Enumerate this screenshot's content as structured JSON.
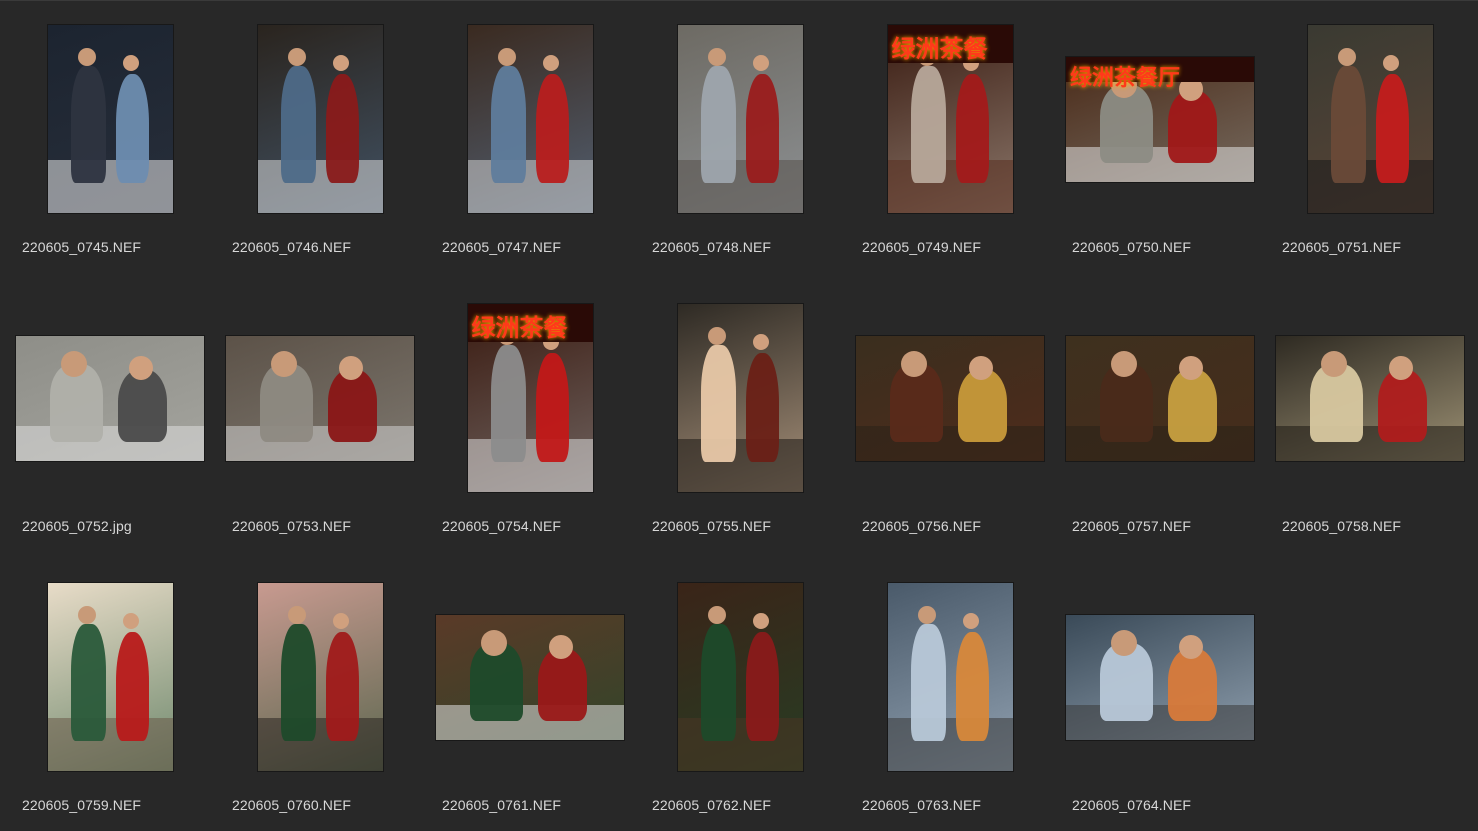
{
  "files": [
    {
      "name": "220605_0745.NEF",
      "orientation": "portrait",
      "bg": "#1c2430",
      "accent": "#6e8db0",
      "accent2": "#2e3440",
      "sign": "",
      "floor": "#e8e8e8"
    },
    {
      "name": "220605_0746.NEF",
      "orientation": "portrait",
      "bg": "#2a241e",
      "accent": "#8a1a1a",
      "accent2": "#4e6a88",
      "sign": "",
      "floor": "#d9d9d9"
    },
    {
      "name": "220605_0747.NEF",
      "orientation": "portrait",
      "bg": "#3a2a20",
      "accent": "#b81e1e",
      "accent2": "#5f7c9c",
      "sign": "",
      "floor": "#cfcfcf"
    },
    {
      "name": "220605_0748.NEF",
      "orientation": "portrait",
      "bg": "#6d6a63",
      "accent": "#9a1c1c",
      "accent2": "#9ea5ad",
      "sign": "",
      "floor": "#55504a"
    },
    {
      "name": "220605_0749.NEF",
      "orientation": "portrait",
      "bg": "#3a1c12",
      "accent": "#a31a1a",
      "accent2": "#b7a89a",
      "sign": "绿洲茶餐",
      "floor": "#5a3020"
    },
    {
      "name": "220605_0750.NEF",
      "orientation": "landscape",
      "bg": "#4a2a18",
      "accent": "#a01818",
      "accent2": "#8c8c84",
      "sign": "绿洲茶餐厅",
      "floor": "#e0e0e0"
    },
    {
      "name": "220605_0751.NEF",
      "orientation": "portrait",
      "bg": "#3a3a32",
      "accent": "#c41c1c",
      "accent2": "#6a4a38",
      "sign": "",
      "floor": "#1a1a1a"
    },
    {
      "name": "220605_0752.jpg",
      "orientation": "landscape",
      "bg": "#8e8e88",
      "accent": "#4a4a4a",
      "accent2": "#b0b0aa",
      "sign": "",
      "floor": "#dcdcdc"
    },
    {
      "name": "220605_0753.NEF",
      "orientation": "landscape",
      "bg": "#5c5248",
      "accent": "#8a1616",
      "accent2": "#8e8a82",
      "sign": "",
      "floor": "#d0d0d0"
    },
    {
      "name": "220605_0754.NEF",
      "orientation": "portrait",
      "bg": "#3a1a10",
      "accent": "#c21818",
      "accent2": "#8c8c8c",
      "sign": "绿洲茶餐",
      "floor": "#d8d8d8"
    },
    {
      "name": "220605_0755.NEF",
      "orientation": "portrait",
      "bg": "#2e2a24",
      "accent": "#6a2016",
      "accent2": "#e8c8a8",
      "sign": "",
      "floor": "#1e1a16"
    },
    {
      "name": "220605_0756.NEF",
      "orientation": "landscape",
      "bg": "#3a2e1e",
      "accent": "#c89a3a",
      "accent2": "#5a2a1a",
      "sign": "",
      "floor": "#2a2218"
    },
    {
      "name": "220605_0757.NEF",
      "orientation": "landscape",
      "bg": "#3e301e",
      "accent": "#c8a040",
      "accent2": "#4a2a1a",
      "sign": "",
      "floor": "#2a2218"
    },
    {
      "name": "220605_0758.NEF",
      "orientation": "landscape",
      "bg": "#2e2a22",
      "accent": "#b01c1c",
      "accent2": "#d8c8a0",
      "sign": "",
      "floor": "#1e1a14"
    },
    {
      "name": "220605_0759.NEF",
      "orientation": "portrait",
      "bg": "#e8dcc8",
      "accent": "#b81a1a",
      "accent2": "#2a5a3a",
      "sign": "",
      "floor": "#6a5a48"
    },
    {
      "name": "220605_0760.NEF",
      "orientation": "portrait",
      "bg": "#c89a90",
      "accent": "#a01a1a",
      "accent2": "#1e4a2a",
      "sign": "",
      "floor": "#2a2420"
    },
    {
      "name": "220605_0761.NEF",
      "orientation": "landscape",
      "bg": "#5a3a28",
      "accent": "#9a1818",
      "accent2": "#1e4a2a",
      "sign": "",
      "floor": "#e0e0e0"
    },
    {
      "name": "220605_0762.NEF",
      "orientation": "portrait",
      "bg": "#3a2418",
      "accent": "#8a1a1a",
      "accent2": "#1e4a2a",
      "sign": "",
      "floor": "#4a3424"
    },
    {
      "name": "220605_0763.NEF",
      "orientation": "portrait",
      "bg": "#4a5a6a",
      "accent": "#d8883a",
      "accent2": "#b8c8d8",
      "sign": "",
      "floor": "#3a3a3a"
    },
    {
      "name": "220605_0764.NEF",
      "orientation": "landscape",
      "bg": "#3a4a58",
      "accent": "#d87a3a",
      "accent2": "#b8c8d8",
      "sign": "",
      "floor": "#3a3a3a"
    }
  ]
}
